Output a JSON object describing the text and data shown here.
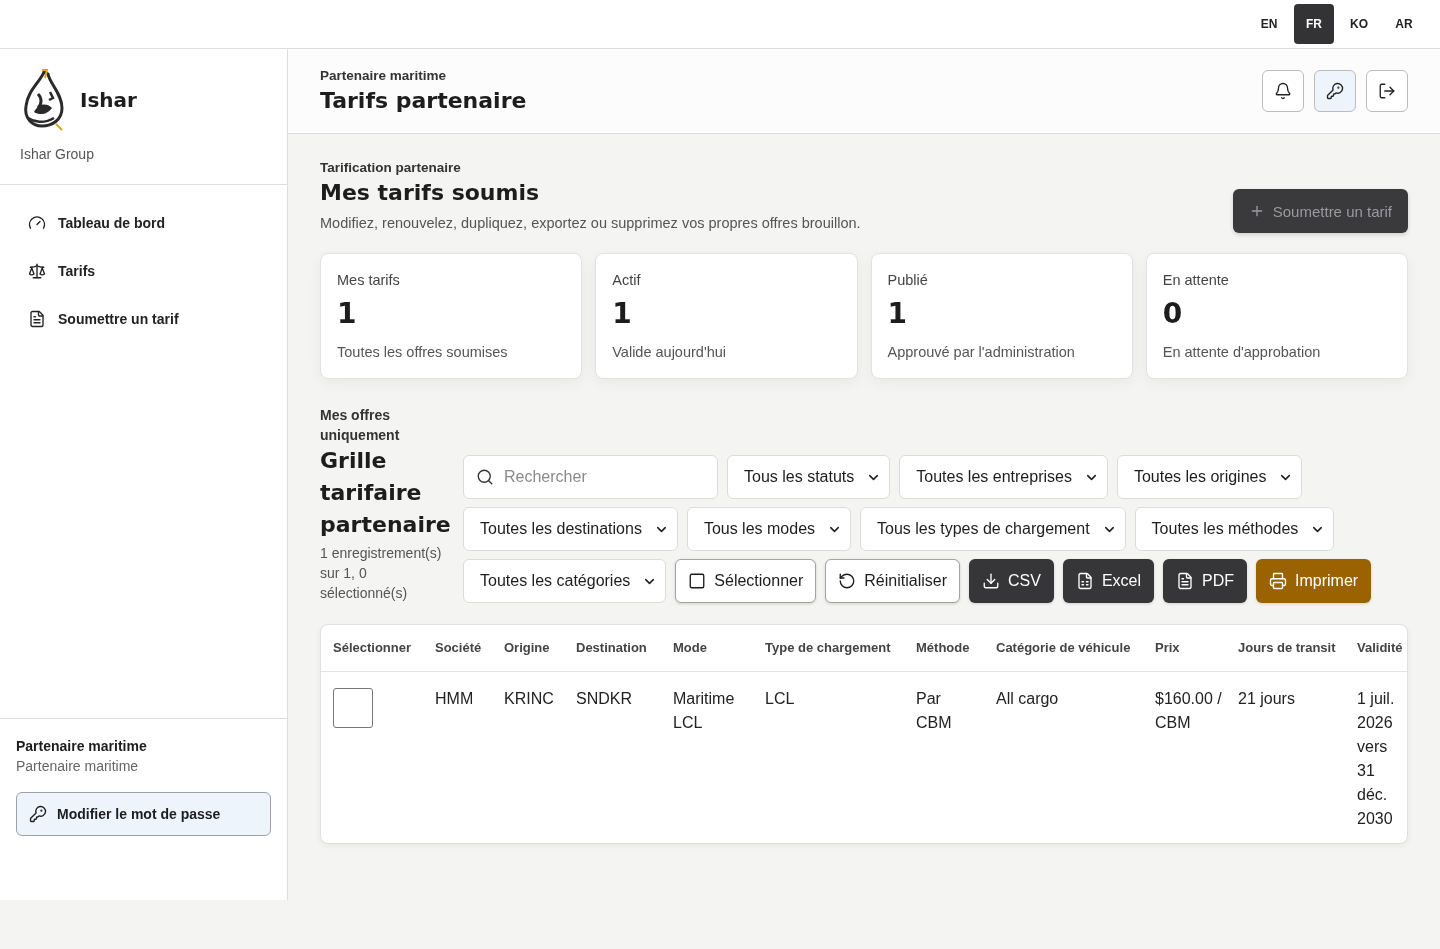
{
  "top_bar": {
    "languages": [
      {
        "label": "EN",
        "selected": false
      },
      {
        "label": "FR",
        "selected": true
      },
      {
        "label": "KO",
        "selected": false
      },
      {
        "label": "AR",
        "selected": false
      }
    ]
  },
  "sidebar": {
    "brand": {
      "name": "Ishar",
      "subtitle": "Ishar Group"
    },
    "nav": [
      {
        "label": "Tableau de bord",
        "selected": false
      },
      {
        "label": "Tarifs",
        "selected": false
      },
      {
        "label": "Soumettre un tarif",
        "selected": false
      }
    ],
    "user": {
      "name": "Partenaire maritime",
      "role": "Partenaire maritime"
    },
    "password_button": "Modifier le mot de passe"
  },
  "header": {
    "eyebrow": "Partenaire maritime",
    "title": "Tarifs partenaire"
  },
  "section": {
    "eyebrow": "Tarification partenaire",
    "title": "Mes tarifs soumis",
    "description": "Modifiez, renouvelez, dupliquez, exportez ou supprimez vos propres offres brouillon.",
    "submit_button": "Soumettre un tarif"
  },
  "stats": [
    {
      "label": "Mes tarifs",
      "value": "1",
      "caption": "Toutes les offres soumises"
    },
    {
      "label": "Actif",
      "value": "1",
      "caption": "Valide aujourd'hui"
    },
    {
      "label": "Publié",
      "value": "1",
      "caption": "Approuvé par l'administration"
    },
    {
      "label": "En attente",
      "value": "0",
      "caption": "En attente d'approbation"
    }
  ],
  "grid": {
    "eyebrow": "Mes offres uniquement",
    "title": "Grille tarifaire partenaire",
    "summary": "1 enregistrement(s) sur 1, 0 sélectionné(s)",
    "controls": [
      {
        "kind": "search",
        "placeholder": "Rechercher"
      },
      {
        "kind": "select",
        "value": "Tous les statuts"
      },
      {
        "kind": "select",
        "value": "Toutes les entreprises"
      },
      {
        "kind": "select",
        "value": "Toutes les origines"
      },
      {
        "kind": "select",
        "value": "Toutes les destinations"
      },
      {
        "kind": "select",
        "value": "Tous les modes"
      },
      {
        "kind": "select",
        "value": "Tous les types de chargement"
      },
      {
        "kind": "select",
        "value": "Toutes les méthodes"
      },
      {
        "kind": "select",
        "value": "Toutes les catégories"
      },
      {
        "kind": "outline-button",
        "label": "Sélectionner"
      },
      {
        "kind": "outline-button",
        "label": "Réinitialiser"
      },
      {
        "kind": "dark-button",
        "label": "CSV"
      },
      {
        "kind": "dark-button",
        "label": "Excel"
      },
      {
        "kind": "dark-button",
        "label": "PDF"
      },
      {
        "kind": "accent-button",
        "label": "Imprimer"
      }
    ],
    "table": {
      "columns": [
        "Sélectionner",
        "Société",
        "Origine",
        "Destination",
        "Mode",
        "Type de chargement",
        "Méthode",
        "Catégorie de véhicule",
        "Prix",
        "Jours de transit",
        "Validité"
      ],
      "rows": [
        {
          "selected": false,
          "cells": [
            "",
            "HMM",
            "KRINC",
            "SNDKR",
            "Maritime LCL",
            "LCL",
            "Par CBM",
            "All cargo",
            "$160.00 / CBM",
            "21 jours",
            "1 juil. 2026 vers 31 déc. 2030"
          ]
        }
      ]
    }
  }
}
